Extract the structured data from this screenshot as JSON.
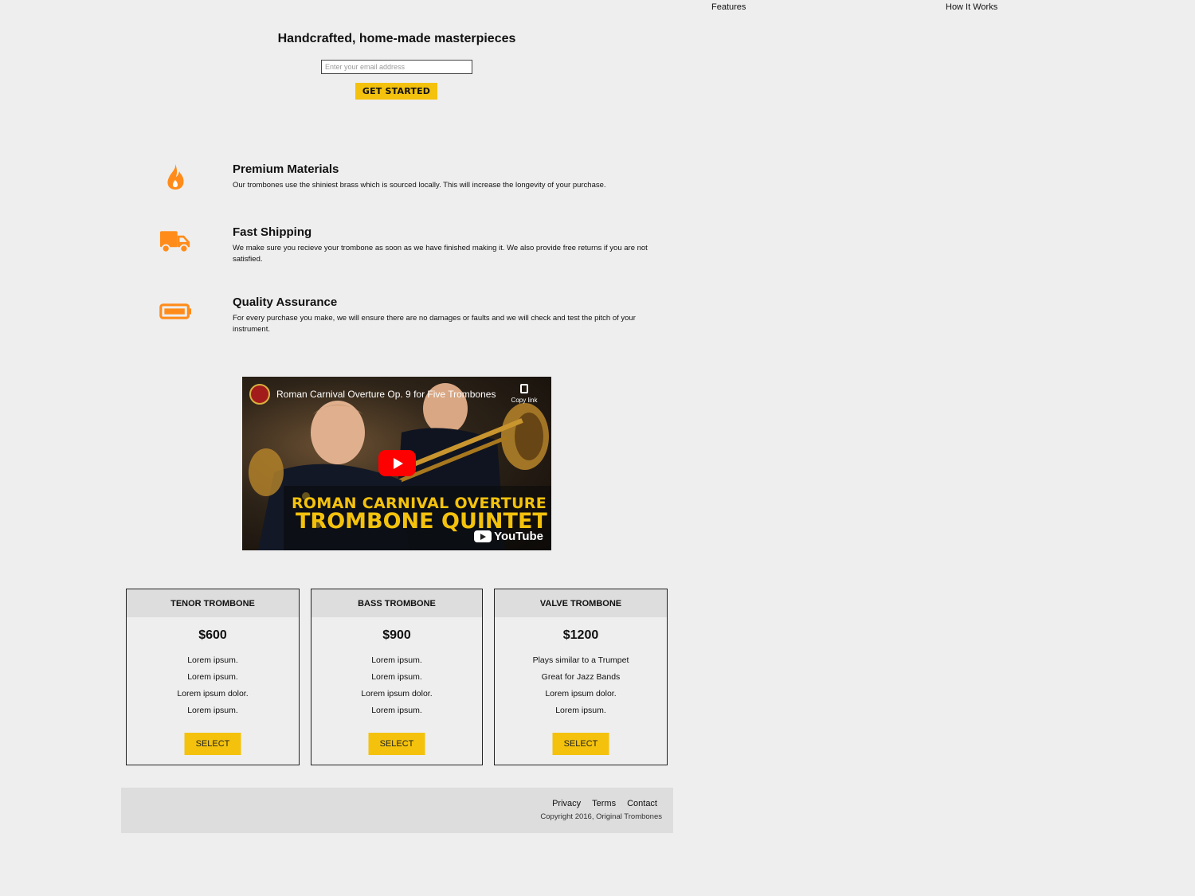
{
  "nav": {
    "features": "Features",
    "how_it_works": "How It Works"
  },
  "hero": {
    "title": "Handcrafted, home-made masterpieces",
    "email_placeholder": "Enter your email address",
    "cta_label": "GET STARTED"
  },
  "features": [
    {
      "icon": "flame-icon",
      "title": "Premium Materials",
      "description": "Our trombones use the shiniest brass which is sourced locally. This will increase the longevity of your purchase."
    },
    {
      "icon": "truck-icon",
      "title": "Fast Shipping",
      "description": "We make sure you recieve your trombone as soon as we have finished making it. We also provide free returns if you are not satisfied."
    },
    {
      "icon": "battery-icon",
      "title": "Quality Assurance",
      "description": "For every purchase you make, we will ensure there are no damages or faults and we will check and test the pitch of your instrument."
    }
  ],
  "video": {
    "title": "Roman Carnival Overture Op. 9 for Five Trombones",
    "copy_link": "Copy link",
    "overlay_line1": "ROMAN CARNIVAL OVERTURE",
    "overlay_line2": "TROMBONE QUINTET",
    "brand": "YouTube"
  },
  "plans": [
    {
      "name": "TENOR TROMBONE",
      "price": "$600",
      "features": [
        "Lorem ipsum.",
        "Lorem ipsum.",
        "Lorem ipsum dolor.",
        "Lorem ipsum."
      ],
      "button": "SELECT"
    },
    {
      "name": "BASS TROMBONE",
      "price": "$900",
      "features": [
        "Lorem ipsum.",
        "Lorem ipsum.",
        "Lorem ipsum dolor.",
        "Lorem ipsum."
      ],
      "button": "SELECT"
    },
    {
      "name": "VALVE TROMBONE",
      "price": "$1200",
      "features": [
        "Plays similar to a Trumpet",
        "Great for Jazz Bands",
        "Lorem ipsum dolor.",
        "Lorem ipsum."
      ],
      "button": "SELECT"
    }
  ],
  "footer": {
    "links": [
      "Privacy",
      "Terms",
      "Contact"
    ],
    "copyright": "Copyright 2016, Original Trombones"
  },
  "colors": {
    "accent": "#f4c20d",
    "icon_orange": "#ff8c1a",
    "background": "#eeeeee",
    "panel": "#dddddd"
  }
}
